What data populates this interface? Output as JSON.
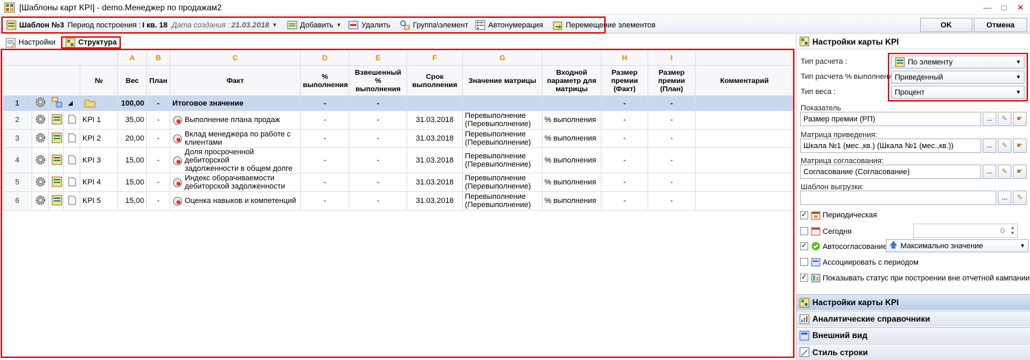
{
  "window": {
    "title": "[Шаблоны карт KPI] - demo.Менеджер по продажам2"
  },
  "toolbar": {
    "template_name": "Шаблон №3",
    "period_label": "Период построения :",
    "period_value": "I кв. 18",
    "created_label": "Дата создания :",
    "created_value": "21.03.2018",
    "add": "Добавить",
    "delete": "Удалить",
    "group_element": "Группа\\элемент",
    "autonumbering": "Автонумерация",
    "move_elements": "Перемещение элементов",
    "ok": "OK",
    "cancel": "Отмена"
  },
  "tabs": {
    "settings": "Настройки",
    "structure": "Структура"
  },
  "grid": {
    "letters": [
      "A",
      "B",
      "C",
      "D",
      "E",
      "F",
      "G",
      "",
      "H",
      "I",
      ""
    ],
    "headers": {
      "num": "№",
      "weight": "Вес",
      "plan": "План",
      "fact": "Факт",
      "pct_line1": "%",
      "pct_line2": "выполнения",
      "wpct_line1": "Взвешенный %",
      "wpct_line2": "выполнения",
      "due_line1": "Срок",
      "due_line2": "выполнения",
      "matrix_value": "Значение матрицы",
      "input_line1": "Входной",
      "input_line2": "параметр для",
      "input_line3": "матрицы",
      "bonus_fact_line1": "Размер",
      "bonus_fact_line2": "премии",
      "bonus_fact_line3": "(Факт)",
      "bonus_plan_line1": "Размер",
      "bonus_plan_line2": "премии",
      "bonus_plan_line3": "(План)",
      "comment": "Комментарий"
    },
    "total": {
      "row": "1",
      "weight": "100,00",
      "plan": "-",
      "fact": "Итоговое значение",
      "pct": "-",
      "wpct": "-",
      "bonus_fact": "-",
      "bonus_plan": "-"
    },
    "rows": [
      {
        "row": "2",
        "num": "KPI 1",
        "weight": "35,00",
        "plan": "-",
        "fact_line1": "Выполнение плана продаж",
        "fact_line2": "",
        "pct": "-",
        "wpct": "-",
        "due": "31.03.2018",
        "matrix_line1": "Перевыполнение",
        "matrix_line2": "(Перевыполнение)",
        "input": "% выполнения",
        "bonus_fact": "-",
        "bonus_plan": "-"
      },
      {
        "row": "3",
        "num": "KPI 2",
        "weight": "20,00",
        "plan": "-",
        "fact_line1": "Вклад менеджера по работе с",
        "fact_line2": "клиентами",
        "pct": "-",
        "wpct": "-",
        "due": "31.03.2018",
        "matrix_line1": "Перевыполнение",
        "matrix_line2": "(Перевыполнение)",
        "input": "% выполнения",
        "bonus_fact": "-",
        "bonus_plan": "-"
      },
      {
        "row": "4",
        "num": "KPI 3",
        "weight": "15,00",
        "plan": "-",
        "fact_line1": "Доля просроченной дебиторской",
        "fact_line2": "задолженности в общем долге",
        "pct": "-",
        "wpct": "-",
        "due": "31.03.2018",
        "matrix_line1": "Перевыполнение",
        "matrix_line2": "(Перевыполнение)",
        "input": "% выполнения",
        "bonus_fact": "-",
        "bonus_plan": "-"
      },
      {
        "row": "5",
        "num": "KPI 4",
        "weight": "15,00",
        "plan": "-",
        "fact_line1": "Индекс оборачиваемости",
        "fact_line2": "дебиторской задолженности",
        "pct": "-",
        "wpct": "-",
        "due": "31.03.2018",
        "matrix_line1": "Перевыполнение",
        "matrix_line2": "(Перевыполнение)",
        "input": "% выполнения",
        "bonus_fact": "-",
        "bonus_plan": "-"
      },
      {
        "row": "6",
        "num": "KPI 5",
        "weight": "15,00",
        "plan": "-",
        "fact_line1": "Оценка навыков и компетенций",
        "fact_line2": "",
        "pct": "-",
        "wpct": "-",
        "due": "31.03.2018",
        "matrix_line1": "Перевыполнение",
        "matrix_line2": "(Перевыполнение)",
        "input": "% выполнения",
        "bonus_fact": "-",
        "bonus_plan": "-"
      }
    ]
  },
  "panel": {
    "title": "Настройки карты KPI",
    "calc_type_label": "Тип расчета :",
    "calc_type_value": "По элементу",
    "calc_pct_label": "Тип расчета % выполнения :",
    "calc_pct_value": "Приведенный",
    "weight_type_label": "Тип веса :",
    "weight_type_value": "Процент",
    "indicator_label": "Показатель",
    "indicator_value": "Размер премии (РП)",
    "reduction_label": "Матрица приведения:",
    "reduction_value": "Шкала №1 (мес.,кв.) (Шкала №1 (мес.,кв.))",
    "approval_label": "Матрица согласования:",
    "approval_value": "Согласование (Согласование)",
    "export_label": "Шаблон выгрузки:",
    "export_value": "",
    "dots": "...",
    "periodic": "Периодическая",
    "today": "Сегодня",
    "today_value": "0",
    "auto_approval": "Автосогласование",
    "auto_approval_value": "Максимально значение",
    "associate_period": "Ассоциировать с периодом",
    "show_status": "Показывать статус при построении вне отчетной кампании",
    "sections": [
      "Настройки карты KPI",
      "Аналитические справочники",
      "Внешний вид",
      "Стиль строки"
    ]
  },
  "colors": {
    "highlight": "#e00000",
    "letters": "#e68a00",
    "total_row": "#c9d8ef"
  }
}
